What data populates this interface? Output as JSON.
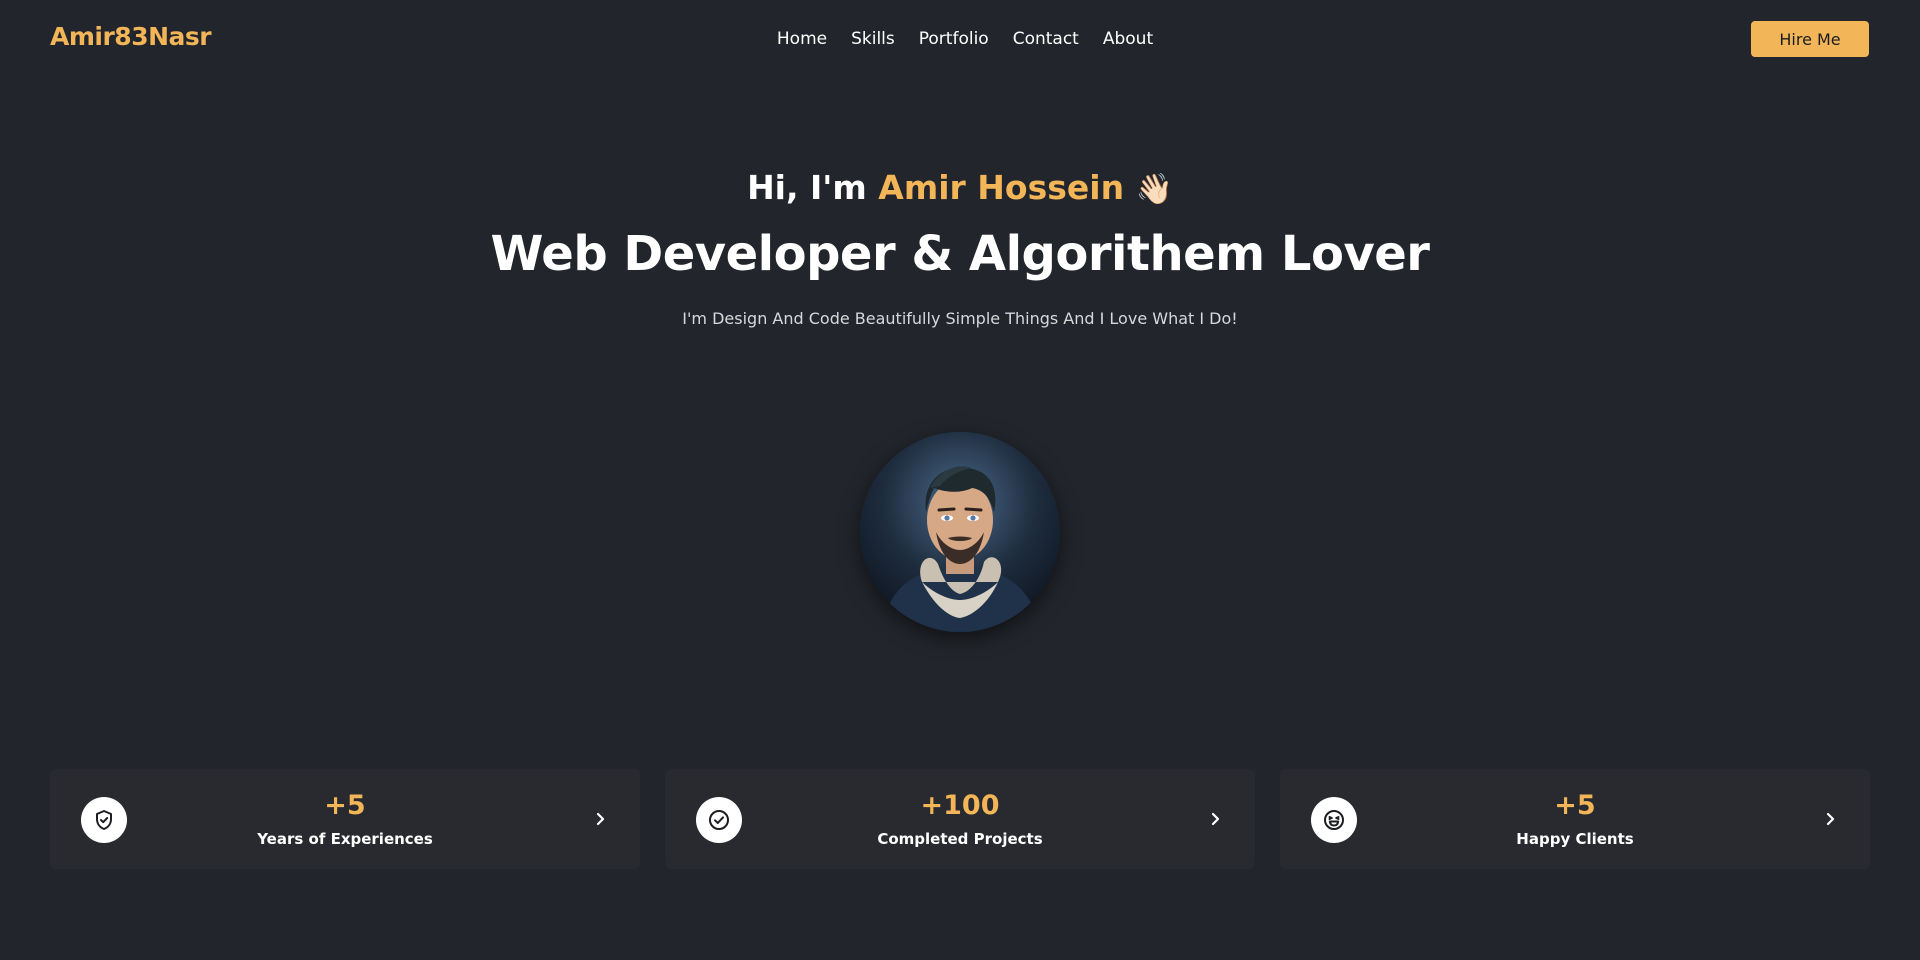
{
  "brand": {
    "logo": "Amir83Nasr",
    "accent_color": "#f2b557",
    "background_color": "#22252b",
    "card_color": "#282a2f"
  },
  "nav": {
    "links": [
      {
        "label": "Home"
      },
      {
        "label": "Skills"
      },
      {
        "label": "Portfolio"
      },
      {
        "label": "Contact"
      },
      {
        "label": "About"
      }
    ],
    "cta_label": "Hire Me"
  },
  "hero": {
    "greeting_prefix": "Hi, I'm",
    "name": "Amir Hossein",
    "wave_emoji": "👋🏻",
    "title": "Web Developer & Algorithem Lover",
    "subtitle": "I'm Design And Code Beautifully Simple Things And I Love What I Do!",
    "avatar_icon": "profile-photo"
  },
  "stats": [
    {
      "icon": "shield-check-icon",
      "value": "+5",
      "label": "Years of Experiences"
    },
    {
      "icon": "check-circle-icon",
      "value": "+100",
      "label": "Completed Projects"
    },
    {
      "icon": "laughing-face-icon",
      "value": "+5",
      "label": "Happy Clients"
    }
  ]
}
